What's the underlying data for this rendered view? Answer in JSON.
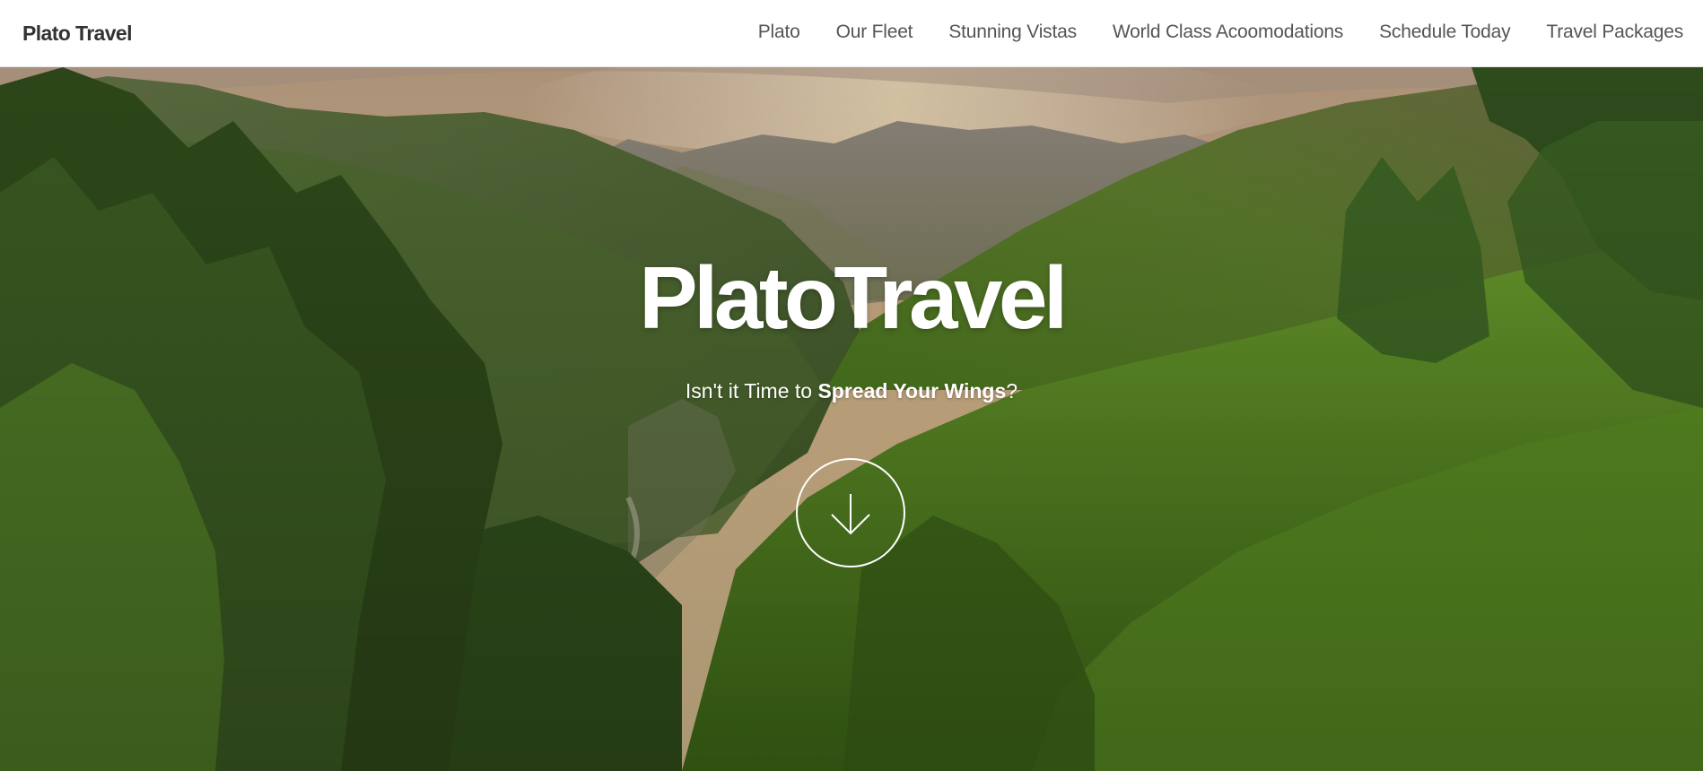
{
  "navbar": {
    "brand": "Plato Travel",
    "links": [
      {
        "label": "Plato"
      },
      {
        "label": "Our Fleet"
      },
      {
        "label": "Stunning Vistas"
      },
      {
        "label": "World Class Acoomodations"
      },
      {
        "label": "Schedule Today"
      },
      {
        "label": "Travel Packages"
      }
    ]
  },
  "hero": {
    "title": "PlatoTravel",
    "subtitle_prefix": "Isn't it Time to ",
    "subtitle_emphasis": "Spread Your Wings",
    "subtitle_suffix": "?",
    "scroll_icon": "arrow-down-icon",
    "background": "mountain-valley-forest-photo"
  }
}
